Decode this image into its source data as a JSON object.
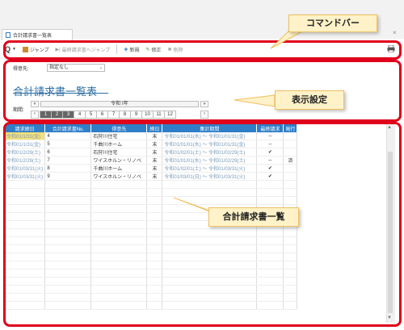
{
  "window": {
    "tab_title": "合計請求書一覧表",
    "close": "×"
  },
  "toolbar": {
    "search": "Q",
    "jump": "ジャンプ",
    "last_jump": "最終請求書へジャンプ",
    "new": "新規",
    "edit": "修正",
    "delete": "削除"
  },
  "settings": {
    "customer_label": "得意先:",
    "customer_value": "指定なし",
    "title": "合計請求書一覧表",
    "period_label": "期間:",
    "year": "令和 Ⅰ年",
    "months": [
      "1",
      "2",
      "3",
      "4",
      "5",
      "6",
      "7",
      "8",
      "9",
      "10",
      "11",
      "12"
    ],
    "selected_months": [
      "1",
      "2",
      "3"
    ]
  },
  "table": {
    "columns": [
      "請求締日",
      "合計請求書No.",
      "得意先",
      "締日",
      "集計期間",
      "最終請求",
      "発行"
    ],
    "rows": [
      {
        "close_date": "令和01/1/31(金)",
        "no": "4",
        "customer": "石狩川住宅",
        "shime": "末",
        "period": "令和01/01/01(水) ～ 令和01/01/31(金)",
        "final": "－",
        "issued": ""
      },
      {
        "close_date": "令和01/1/31(金)",
        "no": "5",
        "customer": "千曲川ホーム",
        "shime": "末",
        "period": "令和01/01/01(水) ～ 令和01/01/31(金)",
        "final": "－",
        "issued": ""
      },
      {
        "close_date": "令和01/2/29(土)",
        "no": "6",
        "customer": "石狩川住宅",
        "shime": "末",
        "period": "令和01/02/01(土) ～ 令和01/02/29(土)",
        "final": "✔",
        "issued": ""
      },
      {
        "close_date": "令和01/2/29(土)",
        "no": "7",
        "customer": "ワイスホルン・リノベ",
        "shime": "末",
        "period": "令和01/01/01(水) ～ 令和01/02/29(土)",
        "final": "－",
        "issued": "済"
      },
      {
        "close_date": "令和01/03/31(火)",
        "no": "8",
        "customer": "千曲川ホーム",
        "shime": "末",
        "period": "令和01/02/01(土) ～ 令和01/03/31(火)",
        "final": "✔",
        "issued": ""
      },
      {
        "close_date": "令和01/03/31(火)",
        "no": "9",
        "customer": "ワイスホルン・リノベ",
        "shime": "末",
        "period": "令和01/03/01(日) ～ 令和01/03/31(火)",
        "final": "✔",
        "issued": ""
      }
    ]
  },
  "callouts": {
    "command_bar": "コマンドバー",
    "display_settings": "表示設定",
    "list": "合計請求書一覧"
  },
  "colors": {
    "accent": "#e0001b",
    "header": "#2f7ec7",
    "note_bg": "#fff2c8",
    "highlight": "#f4e07a"
  }
}
